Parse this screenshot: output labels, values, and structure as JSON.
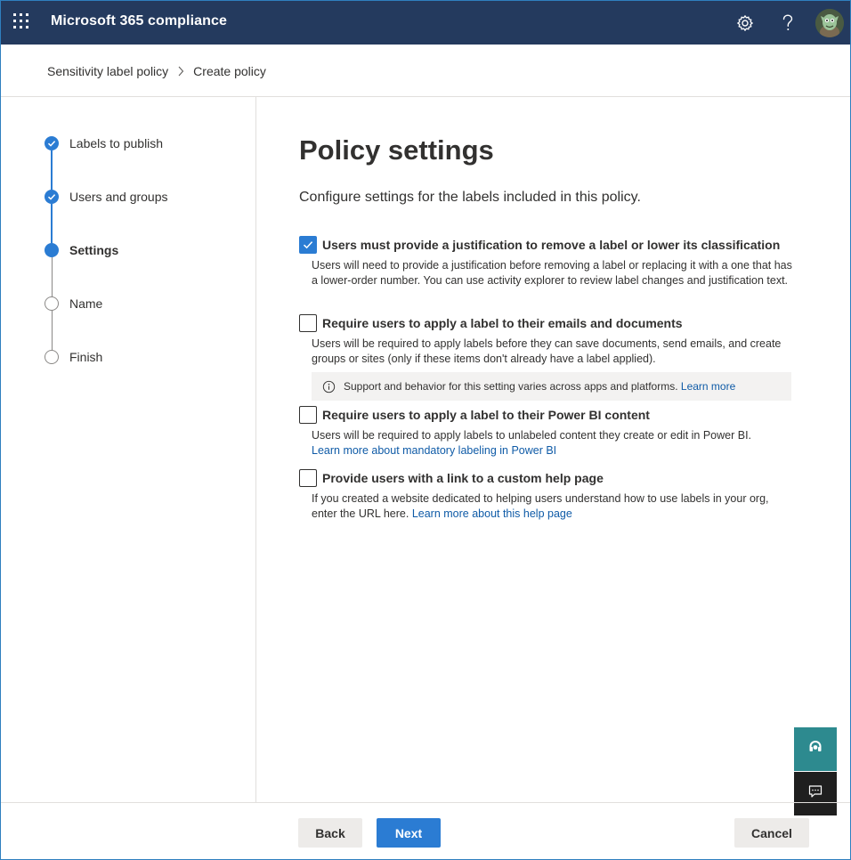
{
  "app": {
    "title": "Microsoft 365 compliance",
    "icons": [
      "waffle-icon",
      "gear-icon",
      "help-icon",
      "avatar"
    ]
  },
  "breadcrumb": {
    "items": [
      "Sensitivity label policy",
      "Create policy"
    ]
  },
  "steps": [
    {
      "label": "Labels to publish",
      "state": "done"
    },
    {
      "label": "Users and groups",
      "state": "done"
    },
    {
      "label": "Settings",
      "state": "current"
    },
    {
      "label": "Name",
      "state": "todo"
    },
    {
      "label": "Finish",
      "state": "todo"
    }
  ],
  "main": {
    "title": "Policy settings",
    "subtitle": "Configure settings for the labels included in this policy."
  },
  "options": [
    {
      "title": "Users must provide a justification to remove a label or lower its classification",
      "checked": true,
      "description": "Users will need to provide a justification before removing a label or replacing it with a one that has a lower-order number. You can use activity explorer to review label changes and justification text."
    },
    {
      "title": "Require users to apply a label to their emails and documents",
      "checked": false,
      "description": "Users will be required to apply labels before they can save documents, send emails, and create groups or sites (only if these items don't already have a label applied).",
      "info": {
        "text": "Support and behavior for this setting varies across apps and platforms.",
        "link": "Learn more"
      }
    },
    {
      "title": "Require users to apply a label to their Power BI content",
      "checked": false,
      "description": "Users will be required to apply labels to unlabeled content they create or edit in Power BI.",
      "link": "Learn more about mandatory labeling in Power BI"
    },
    {
      "title": "Provide users with a link to a custom help page",
      "checked": false,
      "description": "If you created a website dedicated to helping users understand how to use labels in your org, enter the URL here.",
      "link": "Learn more about this help page"
    }
  ],
  "footer": {
    "back_label": "Back",
    "next_label": "Next",
    "cancel_label": "Cancel"
  },
  "colors": {
    "header_bg": "#243a5e",
    "accent": "#2b7cd3",
    "help_fab": "#2d8a8f"
  }
}
